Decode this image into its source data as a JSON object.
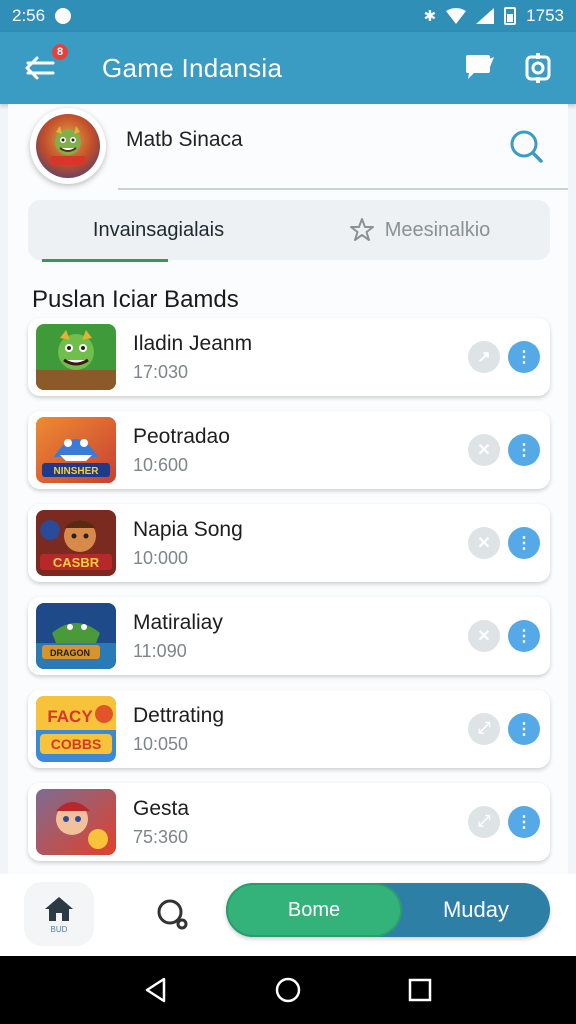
{
  "status_bar": {
    "time": "2:56",
    "right_text": "1753"
  },
  "app_bar": {
    "title": "Game Indansia",
    "badge": "8"
  },
  "profile": {
    "name": "Matb Sinaca"
  },
  "tabs": [
    {
      "label": "Invainsagialais"
    },
    {
      "label": "Meesinalkio"
    }
  ],
  "section_title": "Puslan Iciar Bamds",
  "games": [
    {
      "title": "Iladin Jeanm",
      "sub": "17:030",
      "icon": "green-dragon-icon"
    },
    {
      "title": "Peotradao",
      "sub": "10:600",
      "icon": "blue-shark-icon"
    },
    {
      "title": "Napia Song",
      "sub": "10:000",
      "icon": "caesar-knight-icon"
    },
    {
      "title": "Matiraliay",
      "sub": "11:090",
      "icon": "crocodile-icon"
    },
    {
      "title": "Dettrating",
      "sub": "10:050",
      "icon": "candy-cobbs-icon"
    },
    {
      "title": "Gesta",
      "sub": "75:360",
      "icon": "hero-boy-icon"
    }
  ],
  "bottom_nav": {
    "home_label": "BUD",
    "segment_left": "Bome",
    "segment_right": "Muday"
  },
  "colors": {
    "primary": "#3a9cc2",
    "accent_green": "#33b27a",
    "accent_blue": "#55a9e6"
  }
}
